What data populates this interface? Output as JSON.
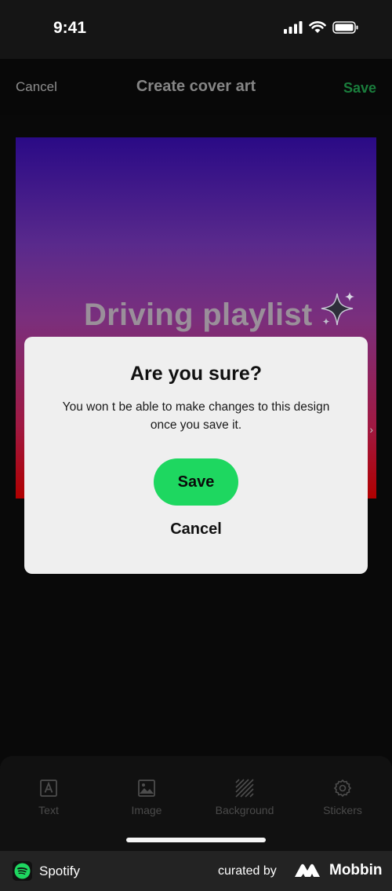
{
  "status_bar": {
    "time": "9:41"
  },
  "nav": {
    "cancel_label": "Cancel",
    "title": "Create cover art",
    "save_label": "Save"
  },
  "canvas": {
    "title": "Driving playlist"
  },
  "dialog": {
    "title": "Are you sure?",
    "message_line1": "You won t be able to make changes to this design",
    "message_line2": "once you save it.",
    "save_label": "Save",
    "cancel_label": "Cancel"
  },
  "toolbar": {
    "items": [
      {
        "label": "Text",
        "icon": "text-icon"
      },
      {
        "label": "Image",
        "icon": "image-icon"
      },
      {
        "label": "Background",
        "icon": "background-icon"
      },
      {
        "label": "Stickers",
        "icon": "stickers-icon"
      }
    ]
  },
  "footer": {
    "app_name": "Spotify",
    "curated_by": "curated by",
    "brand": "Mobbin"
  },
  "colors": {
    "accent_green": "#1ed760",
    "dialog_bg": "#efefef",
    "background": "#090909"
  }
}
